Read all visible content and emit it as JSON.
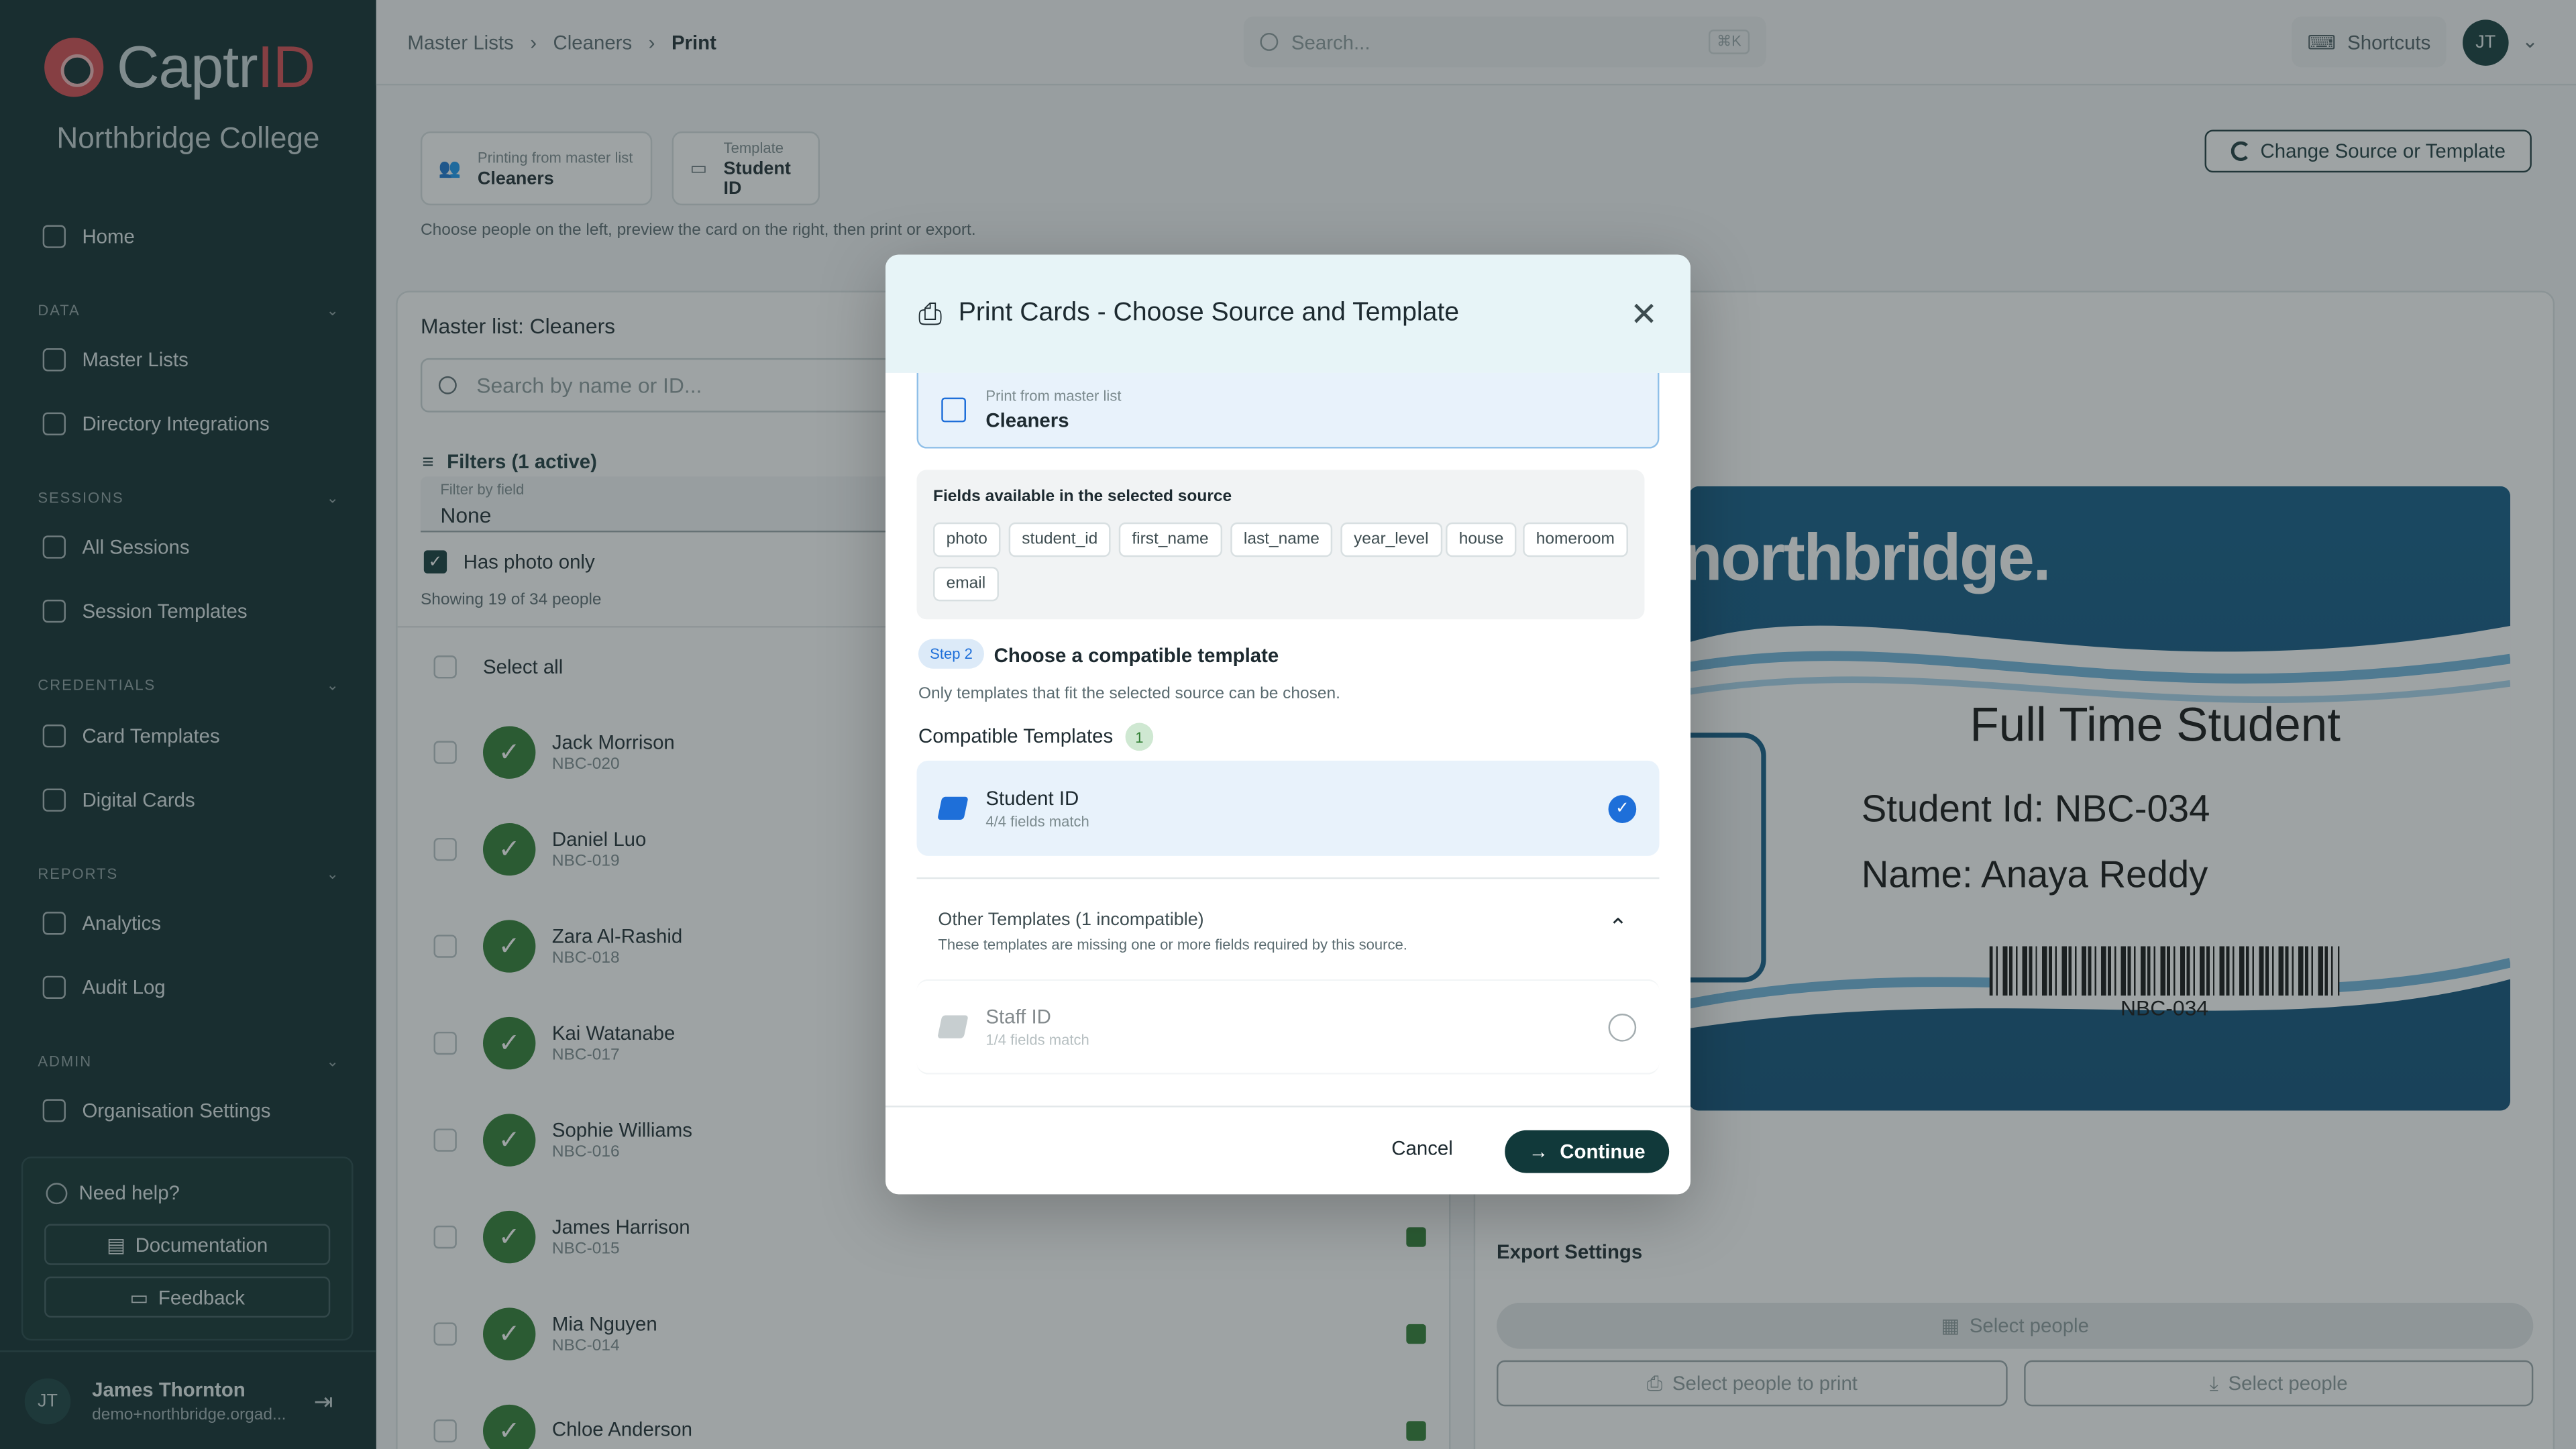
{
  "brand": {
    "name_part1": "Captr",
    "name_part2": "ID",
    "org": "Northbridge College"
  },
  "sidebar": {
    "home": "Home",
    "sections": [
      {
        "label": "DATA",
        "items": [
          "Master Lists",
          "Directory Integrations"
        ]
      },
      {
        "label": "SESSIONS",
        "items": [
          "All Sessions",
          "Session Templates"
        ]
      },
      {
        "label": "CREDENTIALS",
        "items": [
          "Card Templates",
          "Digital Cards"
        ]
      },
      {
        "label": "REPORTS",
        "items": [
          "Analytics",
          "Audit Log"
        ]
      },
      {
        "label": "ADMIN",
        "items": [
          "Organisation Settings"
        ]
      }
    ],
    "help": {
      "title": "Need help?",
      "documentation": "Documentation",
      "feedback": "Feedback"
    },
    "user": {
      "initials": "JT",
      "name": "James Thornton",
      "email": "demo+northbridge.orgad..."
    }
  },
  "topbar": {
    "breadcrumb": [
      "Master Lists",
      "Cleaners",
      "Print"
    ],
    "search_placeholder": "Search...",
    "search_kbd": "⌘K",
    "shortcuts": "Shortcuts",
    "avatar": "JT"
  },
  "page": {
    "source_chip": {
      "label": "Printing from master list",
      "value": "Cleaners"
    },
    "template_chip": {
      "label": "Template",
      "value": "Student ID"
    },
    "hint": "Choose people on the left, preview the card on the right, then print or export.",
    "change_button": "Change Source or Template",
    "list": {
      "title": "Master list: Cleaners",
      "search_placeholder": "Search by name or ID...",
      "filters": "Filters (1 active)",
      "filter_by_field_label": "Filter by field",
      "filter_by_field_value": "None",
      "has_photo": "Has photo only",
      "showing": "Showing 19 of 34 people",
      "select_all": "Select all",
      "people": [
        {
          "name": "Jack Morrison",
          "id": "NBC-020"
        },
        {
          "name": "Daniel Luo",
          "id": "NBC-019"
        },
        {
          "name": "Zara Al-Rashid",
          "id": "NBC-018"
        },
        {
          "name": "Kai Watanabe",
          "id": "NBC-017"
        },
        {
          "name": "Sophie Williams",
          "id": "NBC-016"
        },
        {
          "name": "James Harrison",
          "id": "NBC-015"
        },
        {
          "name": "Mia Nguyen",
          "id": "NBC-014"
        },
        {
          "name": "Chloe Anderson",
          "id": ""
        }
      ]
    },
    "card": {
      "brand": "northbridge.",
      "headline": "Full Time Student",
      "student_id": "Student Id: NBC-034",
      "name": "Name: Anaya Reddy",
      "barcode": "NBC-034"
    },
    "export": {
      "title": "Export Settings",
      "select_people": "Select people",
      "print": "Select people to print",
      "download": "Select people"
    }
  },
  "modal": {
    "title": "Print Cards - Choose Source and Template",
    "source": {
      "label": "Print from master list",
      "value": "Cleaners"
    },
    "fields_title": "Fields available in the selected source",
    "fields": [
      "photo",
      "student_id",
      "first_name",
      "last_name",
      "year_level",
      "house",
      "homeroom",
      "email"
    ],
    "step_badge": "Step 2",
    "step_title": "Choose a compatible template",
    "step_hint": "Only templates that fit the selected source can be chosen.",
    "compatible_label": "Compatible Templates",
    "compatible_count": "1",
    "compatible": [
      {
        "name": "Student ID",
        "match": "4/4 fields match"
      }
    ],
    "other_title": "Other Templates (1 incompatible)",
    "other_hint": "These templates are missing one or more fields required by this source.",
    "other": [
      {
        "name": "Staff ID",
        "match": "1/4 fields match"
      }
    ],
    "cancel": "Cancel",
    "continue": "Continue"
  },
  "colors": {
    "sidebar": "#0e2a2c",
    "brand_red": "#d4494f",
    "primary": "#11393a",
    "selected_bg": "#e8f2fb",
    "check_blue": "#1e6fd9",
    "success": "#2e7d32"
  }
}
